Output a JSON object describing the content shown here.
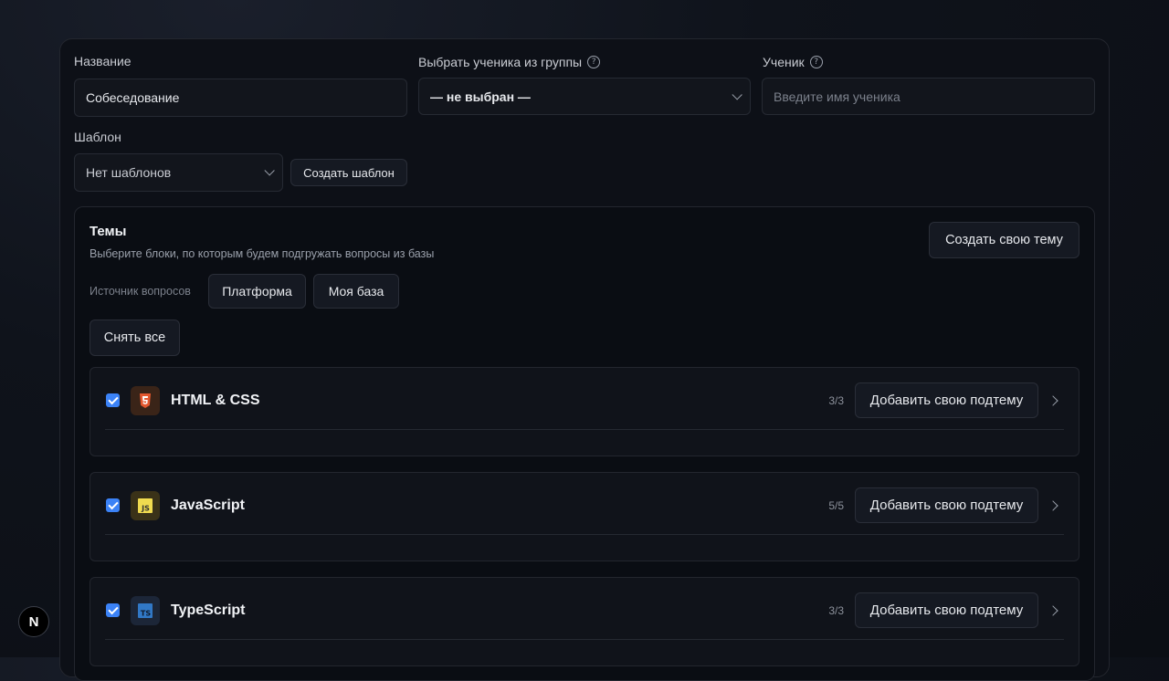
{
  "form": {
    "name_label": "Название",
    "name_value": "Собеседование",
    "group_label": "Выбрать ученика из группы",
    "group_value": "— не выбран —",
    "student_label": "Ученик",
    "student_placeholder": "Введите имя ученика",
    "template_label": "Шаблон",
    "template_value": "Нет шаблонов",
    "create_template_label": "Создать шаблон"
  },
  "themes": {
    "title": "Темы",
    "subtitle": "Выберите блоки, по которым будем подгружать вопросы из базы",
    "create_theme_label": "Создать свою тему",
    "source_label": "Источник вопросов",
    "source_options": [
      "Платформа",
      "Моя база"
    ],
    "clear_all_label": "Снять все",
    "topics": [
      {
        "title": "HTML & CSS",
        "count": "3/3",
        "add_label": "Добавить свою подтему",
        "icon": "html5-icon",
        "color": "#e4572e"
      },
      {
        "title": "JavaScript",
        "count": "5/5",
        "add_label": "Добавить свою подтему",
        "icon": "javascript-icon",
        "color": "#f0db4f"
      },
      {
        "title": "TypeScript",
        "count": "3/3",
        "add_label": "Добавить свою подтему",
        "icon": "typescript-icon",
        "color": "#3178c6"
      }
    ]
  },
  "badge": {
    "letter": "N"
  }
}
